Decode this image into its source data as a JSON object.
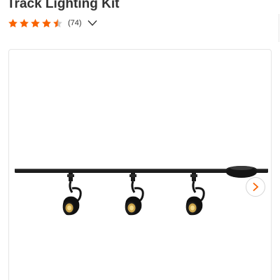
{
  "product": {
    "title": "Track Lighting Kit",
    "rating": {
      "value": 4.5,
      "max": 5,
      "review_count": "(74)",
      "star_color": "#f96302",
      "empty_star_color": "#cccccc"
    },
    "expand_icon": "chevron-down-icon"
  },
  "gallery": {
    "image_subject": "black track lighting fixture with three spotlight heads",
    "next_icon": "chevron-right-icon",
    "arrow_color": "#f96302"
  }
}
